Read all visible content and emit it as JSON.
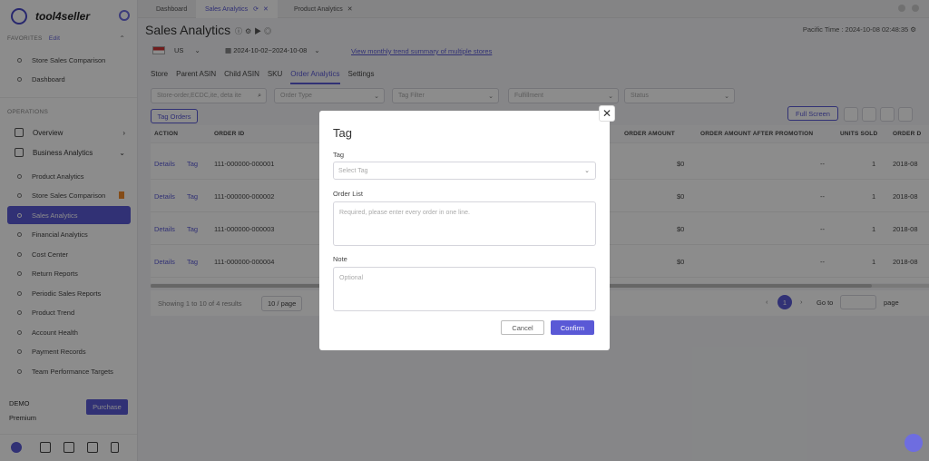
{
  "app": {
    "name": "tool4seller"
  },
  "sidebar": {
    "favorites_label": "FAVORITES",
    "edit_label": "Edit",
    "favorites": [
      "Store Sales Comparison",
      "Dashboard"
    ],
    "operations_label": "OPERATIONS",
    "overview": "Overview",
    "business_analytics": "Business Analytics",
    "items": [
      "Product Analytics",
      "Store Sales Comparison",
      "Sales Analytics",
      "Financial Analytics",
      "Cost Center",
      "Return Reports",
      "Periodic Sales Reports",
      "Product Trend",
      "Account Health",
      "Payment Records",
      "Team Performance Targets"
    ],
    "active": "Sales Analytics",
    "plan": "DEMO",
    "tier": "Premium",
    "purchase": "Purchase"
  },
  "tabs": [
    "Dashboard",
    "Sales Analytics",
    "Product Analytics"
  ],
  "header": {
    "title": "Sales Analytics",
    "timezone": "Pacific Time : 2024-10-08 02:48:35",
    "country": "US",
    "date_range": "2024-10-02~2024-10-08",
    "trend_link": "View monthly trend summary of multiple stores"
  },
  "subtabs": [
    "Store",
    "Parent ASIN",
    "Child ASIN",
    "SKU",
    "Order Analytics",
    "Settings"
  ],
  "filters": {
    "search_placeholder": "Store-order,ECDC,ite, deta ite",
    "order_type": "Order Type",
    "tag_filter": "Tag Filter",
    "fulfillment": "Fulfillment",
    "status": "Status"
  },
  "toolbar": {
    "tag_orders": "Tag Orders",
    "full_screen": "Full Screen"
  },
  "table": {
    "headers": [
      "ACTION",
      "ORDER ID",
      "ORDER AMOUNT",
      "ORDER AMOUNT AFTER PROMOTION",
      "UNITS SOLD",
      "ORDER D"
    ],
    "rows": [
      {
        "details": "Details",
        "tag": "Tag",
        "id": "111-000000-000001",
        "amount": "$0",
        "after": "--",
        "units": "1",
        "date": "2018-08"
      },
      {
        "details": "Details",
        "tag": "Tag",
        "id": "111-000000-000002",
        "amount": "$0",
        "after": "--",
        "units": "1",
        "date": "2018-08"
      },
      {
        "details": "Details",
        "tag": "Tag",
        "id": "111-000000-000003",
        "amount": "$0",
        "after": "--",
        "units": "1",
        "date": "2018-08"
      },
      {
        "details": "Details",
        "tag": "Tag",
        "id": "111-000000-000004",
        "amount": "$0",
        "after": "--",
        "units": "1",
        "date": "2018-08"
      }
    ]
  },
  "pager": {
    "summary": "Showing 1 to 10 of 4 results",
    "page_size": "10 / page",
    "current": "1",
    "goto": "Go to",
    "page": "page"
  },
  "modal": {
    "title": "Tag",
    "tag_label": "Tag",
    "tag_placeholder": "Select Tag",
    "order_label": "Order List",
    "order_placeholder": "Required, please enter every order in one line.",
    "note_label": "Note",
    "note_placeholder": "Optional",
    "cancel": "Cancel",
    "confirm": "Confirm"
  }
}
